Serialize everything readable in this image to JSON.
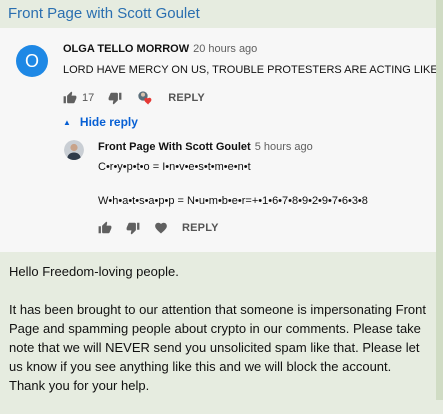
{
  "page": {
    "title": "Front Page with Scott Goulet"
  },
  "comment": {
    "avatar_letter": "O",
    "author": "OLGA TELLO MORROW",
    "time": "20 hours ago",
    "text": "LORD HAVE MERCY ON US, TROUBLE PROTESTERS ARE ACTING LIKE I",
    "like_count": "17",
    "reply_label": "REPLY",
    "hide_reply_label": "Hide reply"
  },
  "reply": {
    "author": "Front Page With Scott Goulet",
    "time": "5 hours ago",
    "line1": "C•r•y•p•t•o = I•n•v•e•s•t•m•e•n•t",
    "line2": "W•h•a•t•s•a•p•p = N•u•m•b•e•r=+•1•6•7•8•9•2•9•7•6•3•8",
    "reply_label": "REPLY"
  },
  "message": {
    "greeting": "Hello Freedom-loving people.",
    "body": "It has been brought to our attention that someone is impersonating Front Page and spamming people about crypto in our comments. Please take note that we will NEVER send you unsolicited spam like that. Please let us know if you see anything like this and we will block the account. Thank you for your help."
  },
  "colors": {
    "link_blue": "#2a6fb0",
    "avatar_blue": "#1e88e5",
    "heart_red": "#e53935"
  },
  "icons": [
    "thumbs-up-icon",
    "thumbs-down-icon",
    "creator-heart-icon",
    "heart-icon",
    "caret-up-icon"
  ]
}
